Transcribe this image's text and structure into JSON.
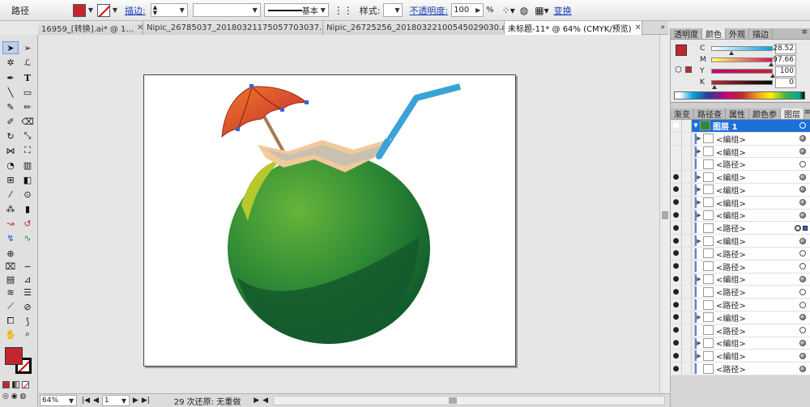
{
  "control_bar": {
    "object_type": "路径",
    "stroke_label": "描边:",
    "stroke_weight": "",
    "stroke_profile": "基本",
    "style_label": "样式:",
    "opacity_label": "不透明度:",
    "opacity_value": "100",
    "opacity_unit": "%",
    "transform_label": "变换",
    "fill_color": "#c1272d"
  },
  "doc_tabs": [
    {
      "label": "16959_[转换].ai* @ 1..."
    },
    {
      "label": "Nipic_26785037_20180321175057703037.ai*"
    },
    {
      "label": "Nipic_26725256_20180322100545029030.ai*"
    },
    {
      "label": "未标题-11* @ 64% (CMYK/预览)",
      "active": true
    }
  ],
  "status_bar": {
    "zoom": "64%",
    "page": "1",
    "undo_text": "29 次还原: 无重做"
  },
  "color_panel": {
    "tabs": [
      "透明度",
      "颜色",
      "外观",
      "描边"
    ],
    "active_tab": "颜色",
    "channels": [
      {
        "name": "C",
        "value": "28.52",
        "fraction": 0.285,
        "gradient": [
          "#ffffff",
          "#00a3e0"
        ]
      },
      {
        "name": "M",
        "value": "97.66",
        "fraction": 0.977,
        "gradient": [
          "#ffff66",
          "#d4145a"
        ]
      },
      {
        "name": "Y",
        "value": "100",
        "fraction": 1.0,
        "gradient": [
          "#c9007a",
          "#c1272d"
        ]
      },
      {
        "name": "K",
        "value": "0",
        "fraction": 0.0,
        "gradient": [
          "#c1272d",
          "#000000"
        ]
      }
    ],
    "fill_color": "#c1272d"
  },
  "layers_panel": {
    "tabs": [
      "渐变",
      "路径查",
      "属性",
      "颜色参",
      "图层"
    ],
    "active_tab": "图层",
    "layer_name": "图层 1",
    "rows": [
      {
        "label": "<编组>",
        "visible": false,
        "expand": true,
        "target": "full"
      },
      {
        "label": "<编组>",
        "visible": false,
        "expand": true,
        "target": "full"
      },
      {
        "label": "<路径>",
        "visible": false,
        "expand": false,
        "target": "empty"
      },
      {
        "label": "<编组>",
        "visible": true,
        "expand": true,
        "target": "full"
      },
      {
        "label": "<编组>",
        "visible": true,
        "expand": true,
        "target": "full"
      },
      {
        "label": "<编组>",
        "visible": true,
        "expand": true,
        "target": "full"
      },
      {
        "label": "<编组>",
        "visible": true,
        "expand": true,
        "target": "full"
      },
      {
        "label": "<路径>",
        "visible": true,
        "expand": false,
        "target": "selected"
      },
      {
        "label": "<编组>",
        "visible": true,
        "expand": true,
        "target": "full"
      },
      {
        "label": "<路径>",
        "visible": true,
        "expand": false,
        "target": "empty"
      },
      {
        "label": "<路径>",
        "visible": true,
        "expand": false,
        "target": "empty"
      },
      {
        "label": "<编组>",
        "visible": true,
        "expand": true,
        "target": "full"
      },
      {
        "label": "<路径>",
        "visible": true,
        "expand": false,
        "target": "empty"
      },
      {
        "label": "<路径>",
        "visible": true,
        "expand": false,
        "target": "empty"
      },
      {
        "label": "<编组>",
        "visible": true,
        "expand": true,
        "target": "full"
      },
      {
        "label": "<路径>",
        "visible": true,
        "expand": false,
        "target": "empty"
      },
      {
        "label": "<编组>",
        "visible": true,
        "expand": true,
        "target": "full"
      },
      {
        "label": "<编组>",
        "visible": true,
        "expand": true,
        "target": "full"
      },
      {
        "label": "<路径>",
        "visible": true,
        "expand": false,
        "target": "full"
      }
    ]
  },
  "tools_panel": {
    "fill_color": "#c1272d"
  }
}
